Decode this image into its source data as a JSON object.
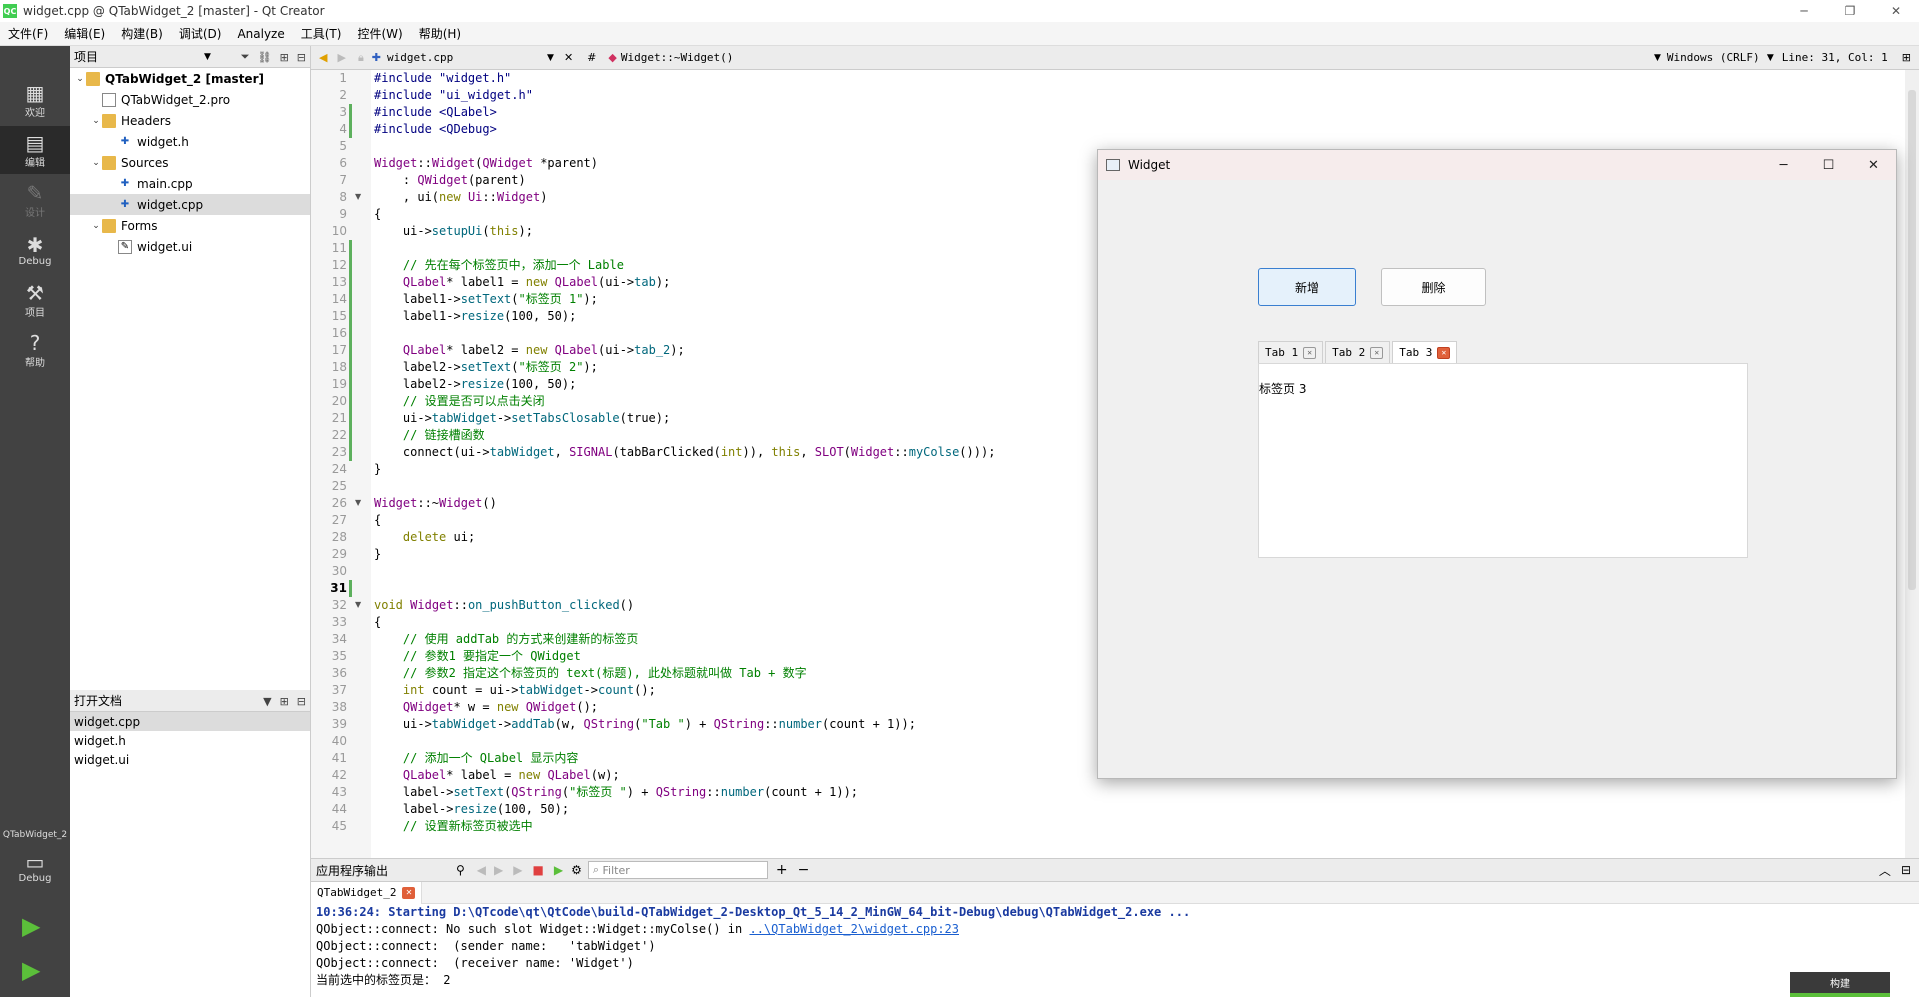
{
  "window": {
    "title": "widget.cpp @ QTabWidget_2 [master] - Qt Creator",
    "app_icon": "QC"
  },
  "menu": [
    "文件(F)",
    "编辑(E)",
    "构建(B)",
    "调试(D)",
    "Analyze",
    "工具(T)",
    "控件(W)",
    "帮助(H)"
  ],
  "modes": [
    {
      "label": "欢迎",
      "icon": "grid-icon"
    },
    {
      "label": "编辑",
      "icon": "edit-icon"
    },
    {
      "label": "设计",
      "icon": "pen-icon"
    },
    {
      "label": "Debug",
      "icon": "bug-icon"
    },
    {
      "label": "项目",
      "icon": "wrench-icon"
    },
    {
      "label": "帮助",
      "icon": "help-icon"
    }
  ],
  "kit": {
    "project": "QTabWidget_2",
    "build": "Debug"
  },
  "project_panel": {
    "title": "项目",
    "tree": [
      {
        "label": "QTabWidget_2 [master]",
        "type": "project",
        "expanded": true
      },
      {
        "label": "QTabWidget_2.pro",
        "type": "pro"
      },
      {
        "label": "Headers",
        "type": "folder",
        "expanded": true
      },
      {
        "label": "widget.h",
        "type": "header"
      },
      {
        "label": "Sources",
        "type": "folder",
        "expanded": true
      },
      {
        "label": "main.cpp",
        "type": "source"
      },
      {
        "label": "widget.cpp",
        "type": "source",
        "selected": true
      },
      {
        "label": "Forms",
        "type": "folder",
        "expanded": true
      },
      {
        "label": "widget.ui",
        "type": "form"
      }
    ]
  },
  "open_docs": {
    "title": "打开文档",
    "items": [
      "widget.cpp",
      "widget.h",
      "widget.ui"
    ]
  },
  "editor_toolbar": {
    "file": "widget.cpp",
    "symbol": "Widget::~Widget()",
    "line_endings": "Windows (CRLF)",
    "position": "Line: 31, Col: 1"
  },
  "current_line": 31,
  "code": [
    "#include \"widget.h\"",
    "#include \"ui_widget.h\"",
    "#include <QLabel>",
    "#include <QDebug>",
    "",
    "Widget::Widget(QWidget *parent)",
    "    : QWidget(parent)",
    "    , ui(new Ui::Widget)",
    "{",
    "    ui->setupUi(this);",
    "",
    "    // 先在每个标签页中，添加一个 Lable",
    "    QLabel* label1 = new QLabel(ui->tab);",
    "    label1->setText(\"标签页 1\");",
    "    label1->resize(100, 50);",
    "",
    "    QLabel* label2 = new QLabel(ui->tab_2);",
    "    label2->setText(\"标签页 2\");",
    "    label2->resize(100, 50);",
    "    // 设置是否可以点击关闭",
    "    ui->tabWidget->setTabsClosable(true);",
    "    // 链接槽函数",
    "    connect(ui->tabWidget, SIGNAL(tabBarClicked(int)), this, SLOT(Widget::myColse()));",
    "}",
    "",
    "Widget::~Widget()",
    "{",
    "    delete ui;",
    "}",
    "",
    "",
    "void Widget::on_pushButton_clicked()",
    "{",
    "    // 使用 addTab 的方式来创建新的标签页",
    "    // 参数1 要指定一个 QWidget",
    "    // 参数2 指定这个标签页的 text(标题), 此处标题就叫做 Tab + 数字",
    "    int count = ui->tabWidget->count();",
    "    QWidget* w = new QWidget();",
    "    ui->tabWidget->addTab(w, QString(\"Tab \") + QString::number(count + 1));",
    "",
    "    // 添加一个 QLabel 显示内容",
    "    QLabel* label = new QLabel(w);",
    "    label->setText(QString(\"标签页 \") + QString::number(count + 1));",
    "    label->resize(100, 50);",
    "    // 设置新标签页被选中"
  ],
  "running_app": {
    "title": "Widget",
    "buttons": {
      "add": "新增",
      "remove": "删除"
    },
    "tabs": [
      "Tab 1",
      "Tab 2",
      "Tab 3"
    ],
    "active_tab": 2,
    "page_text": "标签页 3"
  },
  "output": {
    "title": "应用程序输出",
    "filter_placeholder": "Filter",
    "tab": "QTabWidget_2",
    "lines": [
      {
        "text": "10:36:24: Starting D:\\QTcode\\qt\\QtCode\\build-QTabWidget_2-Desktop_Qt_5_14_2_MinGW_64_bit-Debug\\debug\\QTabWidget_2.exe ...",
        "style": "blue"
      },
      {
        "text": "QObject::connect: No such slot Widget::Widget::myColse() in ",
        "link": "..\\QTabWidget_2\\widget.cpp:23"
      },
      {
        "text": "QObject::connect:  (sender name:   'tabWidget')"
      },
      {
        "text": "QObject::connect:  (receiver name: 'Widget')"
      },
      {
        "text": "当前选中的标签页是： 2"
      }
    ]
  },
  "build_label": "构建"
}
